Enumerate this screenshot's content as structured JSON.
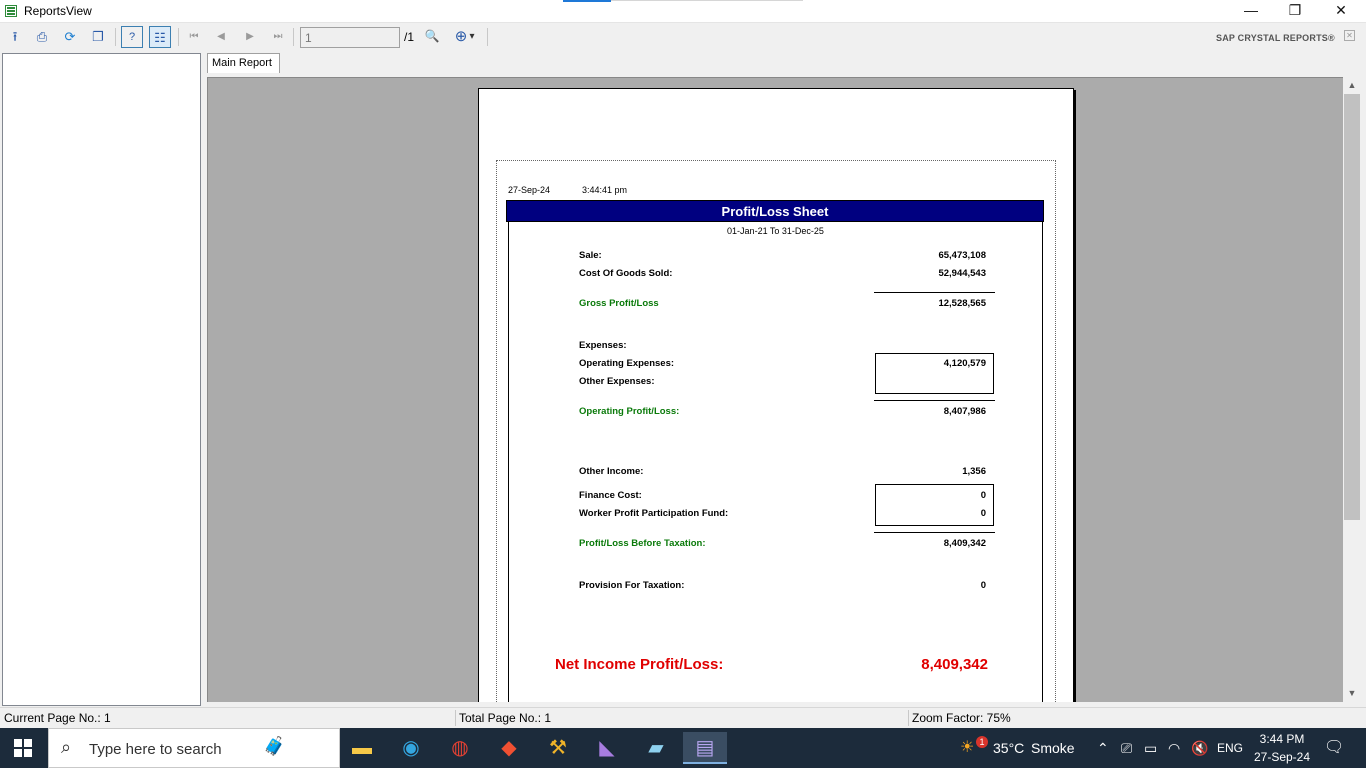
{
  "window": {
    "title": "ReportsView",
    "minimize": "—",
    "maximize": "❐",
    "close": "✕"
  },
  "toolbar": {
    "page_input_value": "1",
    "page_total": "/1",
    "brand": "SAP CRYSTAL REPORTS®",
    "brand_close": "✕",
    "icons": {
      "export": "⭱",
      "print": "⎙",
      "refresh": "⟳",
      "copy": "❐",
      "help": "?",
      "group_tree": "☷",
      "first": "⏮",
      "prev": "◀",
      "next": "▶",
      "last": "⏭",
      "find": "🔍",
      "zoom": "⊕",
      "zoom_dropdown": "▾"
    }
  },
  "tabs": [
    {
      "label": "Main Report"
    }
  ],
  "report": {
    "date": "27-Sep-24",
    "time": "3:44:41 pm",
    "title": "Profit/Loss Sheet",
    "period": "01-Jan-21 To 31-Dec-25",
    "sale_label": "Sale:",
    "sale_value": "65,473,108",
    "cogs_label": "Cost Of Goods Sold:",
    "cogs_value": "52,944,543",
    "gross_label": "Gross Profit/Loss",
    "gross_value": "12,528,565",
    "expenses_label": "Expenses:",
    "opex_label": "Operating Expenses:",
    "opex_value": "4,120,579",
    "other_exp_label": "Other Expenses:",
    "op_profit_label": "Operating Profit/Loss:",
    "op_profit_value": "8,407,986",
    "other_income_label": "Other Income:",
    "other_income_value": "1,356",
    "finance_label": "Finance Cost:",
    "finance_value": "0",
    "wppf_label": "Worker Profit Participation Fund:",
    "wppf_value": "0",
    "pbt_label": "Profit/Loss Before Taxation:",
    "pbt_value": "8,409,342",
    "tax_label": "Provision For Taxation:",
    "tax_value": "0",
    "net_label": "Net Income Profit/Loss:",
    "net_value": "8,409,342"
  },
  "status": {
    "current": "Current Page No.: 1",
    "total": "Total Page No.: 1",
    "zoom": "Zoom Factor: 75%"
  },
  "taskbar": {
    "search_placeholder": "Type here to search",
    "weather_temp": "35°C",
    "weather_desc": "Smoke",
    "language": "ENG",
    "time": "3:44 PM",
    "date": "27-Sep-24",
    "weather_badge": "1"
  },
  "colors": {
    "report_header": "#000080",
    "green_label": "#0a7a0a",
    "net_red": "#e00000",
    "viewer_bg": "#ababab",
    "taskbar": "#1c2b3b"
  }
}
